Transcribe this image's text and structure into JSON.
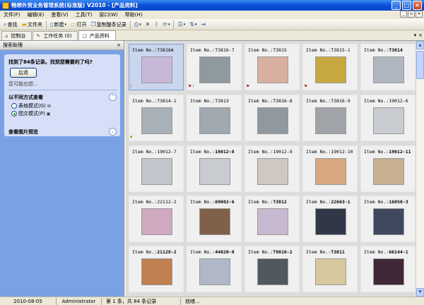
{
  "window": {
    "title": "畅想外贸业务管理系统(标准版) V2010 - [产品资料]"
  },
  "menu": [
    "文件(F)",
    "编辑(E)",
    "查看(V)",
    "工具(T)",
    "窗口(W)",
    "帮助(H)"
  ],
  "toolbar": {
    "search": "查找",
    "folder": "文件夹",
    "new": "新建",
    "open": "打开",
    "copy_record": "复制整条记录"
  },
  "tabs": [
    "控制台",
    "工作任务 (0)",
    "产品资料"
  ],
  "left_panel": {
    "title": "搜索助理",
    "found": "找到了84条记录。找到您需要的了吗?",
    "back": "后退",
    "maybe": "您可能也想...",
    "view_section": "以不同方式查看",
    "options": [
      {
        "label": "表格模式(G)",
        "checked": false
      },
      {
        "label": "图文模式(P)",
        "checked": true
      }
    ],
    "preview": "查看图片预览"
  },
  "grid": {
    "prefix": "Item No.:",
    "items": [
      {
        "id": "T3816A",
        "bold": false,
        "thumb": "#c8b8d8",
        "flag": false,
        "clip": true,
        "lock": false
      },
      {
        "id": "T3816-7",
        "bold": false,
        "thumb": "#8f9aa0",
        "flag": true,
        "clip": true,
        "lock": false
      },
      {
        "id": "T3815",
        "bold": false,
        "thumb": "#d8b0a0",
        "flag": true,
        "clip": false,
        "lock": false
      },
      {
        "id": "T3815-1",
        "bold": false,
        "thumb": "#c8a840",
        "flag": true,
        "clip": false,
        "lock": false
      },
      {
        "id": "T3814",
        "bold": true,
        "thumb": "#b0b6c0",
        "flag": false,
        "clip": false,
        "lock": false
      },
      {
        "id": "T3814-1",
        "bold": false,
        "thumb": "#a8b0b8",
        "flag": false,
        "clip": false,
        "lock": true
      },
      {
        "id": "T3813",
        "bold": false,
        "thumb": "#a0a8b0",
        "flag": false,
        "clip": false,
        "lock": false
      },
      {
        "id": "T3816-8",
        "bold": false,
        "thumb": "#9098a0",
        "flag": false,
        "clip": false,
        "lock": false
      },
      {
        "id": "T3816-9",
        "bold": false,
        "thumb": "#a0a4a8",
        "flag": false,
        "clip": false,
        "lock": false
      },
      {
        "id": "19012-6",
        "bold": false,
        "thumb": "#c8ccd0",
        "flag": false,
        "clip": false,
        "lock": false
      },
      {
        "id": "19012-7",
        "bold": false,
        "thumb": "#c0c6cc",
        "flag": false,
        "clip": false,
        "lock": false
      },
      {
        "id": "19012-8",
        "bold": true,
        "thumb": "#c8ccd0",
        "flag": false,
        "clip": false,
        "lock": false
      },
      {
        "id": "19012-9",
        "bold": false,
        "thumb": "#d0c8c0",
        "flag": false,
        "clip": false,
        "lock": false
      },
      {
        "id": "19012-10",
        "bold": false,
        "thumb": "#d8a880",
        "flag": false,
        "clip": false,
        "lock": false
      },
      {
        "id": "19012-11",
        "bold": true,
        "thumb": "#c8b090",
        "flag": false,
        "clip": false,
        "lock": false
      },
      {
        "id": "22112-2",
        "bold": false,
        "thumb": "#d0a8c0",
        "flag": false,
        "clip": false,
        "lock": false
      },
      {
        "id": "69002-6",
        "bold": true,
        "thumb": "#806048",
        "flag": false,
        "clip": false,
        "lock": false
      },
      {
        "id": "T3812",
        "bold": true,
        "thumb": "#c8b8d0",
        "flag": false,
        "clip": false,
        "lock": false
      },
      {
        "id": "22663-1",
        "bold": true,
        "thumb": "#303848",
        "flag": false,
        "clip": false,
        "lock": false
      },
      {
        "id": "16050-3",
        "bold": true,
        "thumb": "#404860",
        "flag": false,
        "clip": false,
        "lock": false
      },
      {
        "id": "21128-2",
        "bold": true,
        "thumb": "#c08050",
        "flag": false,
        "clip": false,
        "lock": false
      },
      {
        "id": "44020-8",
        "bold": true,
        "thumb": "#b0b8c8",
        "flag": false,
        "clip": false,
        "lock": false
      },
      {
        "id": "T9016-2",
        "bold": true,
        "thumb": "#505860",
        "flag": false,
        "clip": false,
        "lock": false
      },
      {
        "id": "T3811",
        "bold": true,
        "thumb": "#d8c8a0",
        "flag": false,
        "clip": false,
        "lock": false
      },
      {
        "id": "66144-1",
        "bold": true,
        "thumb": "#402838",
        "flag": false,
        "clip": false,
        "lock": false
      }
    ]
  },
  "status": {
    "date": "2010-08-05",
    "user": "Administrator",
    "record": "第 1 条，共 84 条记录",
    "state": "就绪..."
  }
}
